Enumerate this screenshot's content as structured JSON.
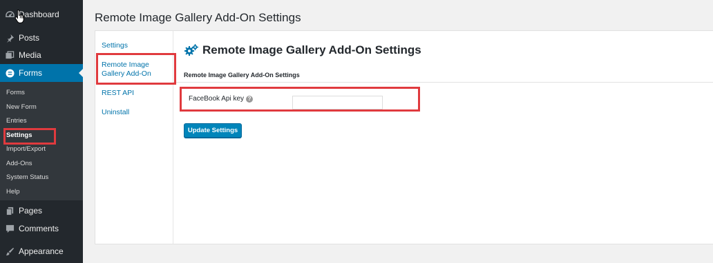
{
  "sidebar": {
    "top_items": [
      {
        "label": "Dashboard",
        "icon": "dashboard-icon"
      },
      {
        "label": "Posts",
        "icon": "pin-icon"
      },
      {
        "label": "Media",
        "icon": "media-icon"
      },
      {
        "label": "Forms",
        "icon": "forms-icon",
        "current": true
      },
      {
        "label": "Pages",
        "icon": "pages-icon"
      },
      {
        "label": "Comments",
        "icon": "comment-icon"
      },
      {
        "label": "Appearance",
        "icon": "brush-icon"
      }
    ],
    "submenu": [
      {
        "label": "Forms"
      },
      {
        "label": "New Form"
      },
      {
        "label": "Entries"
      },
      {
        "label": "Settings",
        "active": true
      },
      {
        "label": "Import/Export"
      },
      {
        "label": "Add-Ons"
      },
      {
        "label": "System Status"
      },
      {
        "label": "Help"
      }
    ]
  },
  "page": {
    "title": "Remote Image Gallery Add-On Settings"
  },
  "tabs": [
    {
      "label": "Settings"
    },
    {
      "label": "Remote Image Gallery Add-On",
      "active": true
    },
    {
      "label": "REST API"
    },
    {
      "label": "Uninstall"
    }
  ],
  "content": {
    "heading": "Remote Image Gallery Add-On Settings",
    "subheading": "Remote Image Gallery Add-On Settings",
    "field_label": "FaceBook Api key",
    "help_glyph": "?",
    "input_value": "",
    "button_label": "Update Settings"
  },
  "colors": {
    "sidebar_bg": "#23282d",
    "submenu_bg": "#32373c",
    "current_menu": "#0073aa",
    "button": "#0085ba",
    "highlight": "#e03a3e"
  }
}
